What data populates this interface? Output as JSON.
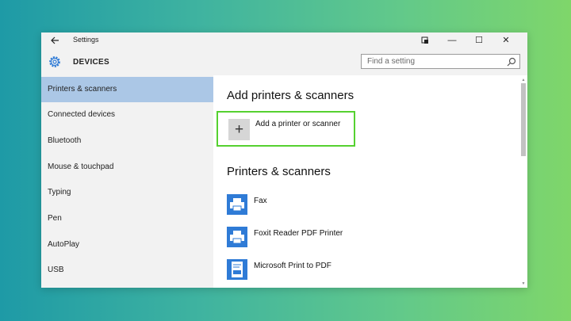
{
  "window": {
    "title": "Settings",
    "back_icon": "arrow-left-icon",
    "controls": {
      "snap_icon": "pin-icon",
      "minimize": "—",
      "maximize": "☐",
      "close": "✕"
    }
  },
  "header": {
    "icon": "gear-icon",
    "title": "DEVICES",
    "search": {
      "placeholder": "Find a setting",
      "value": "",
      "icon": "search-icon"
    }
  },
  "sidebar": {
    "selected_index": 0,
    "items": [
      {
        "label": "Printers & scanners"
      },
      {
        "label": "Connected devices"
      },
      {
        "label": "Bluetooth"
      },
      {
        "label": "Mouse & touchpad"
      },
      {
        "label": "Typing"
      },
      {
        "label": "Pen"
      },
      {
        "label": "AutoPlay"
      },
      {
        "label": "USB"
      }
    ]
  },
  "main": {
    "add_section_title": "Add printers & scanners",
    "add_button": {
      "label": "Add a printer or scanner",
      "icon": "plus-icon"
    },
    "list_section_title": "Printers & scanners",
    "printers": [
      {
        "name": "Fax",
        "icon": "printer-icon"
      },
      {
        "name": "Foxit Reader PDF Printer",
        "icon": "printer-icon"
      },
      {
        "name": "Microsoft Print to PDF",
        "icon": "pdf-printer-icon"
      }
    ]
  },
  "colors": {
    "accent": "#2f7bd6",
    "selected_nav": "#abc7e6",
    "highlight_border": "#55d130"
  }
}
